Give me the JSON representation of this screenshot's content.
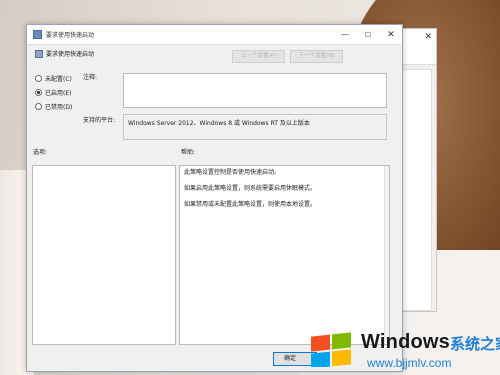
{
  "dialog": {
    "title": "要求使用快速启动",
    "policy_title": "要求使用快速启动",
    "prev_button": "上一个设置(P)",
    "next_button": "下一个设置(N)",
    "radios": [
      {
        "label": "未配置(C)",
        "selected": false
      },
      {
        "label": "已启用(E)",
        "selected": true
      },
      {
        "label": "已禁用(D)",
        "selected": false
      }
    ],
    "comment_label": "注释:",
    "comment_value": "",
    "platform_label": "支持的平台:",
    "platform_value": "Windows Server 2012、Windows 8 或 Windows RT 及以上版本",
    "options_label": "选项:",
    "help_label": "帮助:",
    "help_text": [
      "此策略设置控制是否使用快速启动。",
      "如果启用此策略设置，则系统需要启用休眠模式。",
      "如果禁用或未配置此策略设置，则使用本地设置。"
    ],
    "ok_button": "确定"
  },
  "watermark": {
    "brand": "Windows",
    "cn": "系统之家",
    "url": "www.bjjmlv.com",
    "colors": {
      "red": "#f25022",
      "green": "#7fba00",
      "blue": "#00a4ef",
      "yellow": "#ffb900"
    }
  },
  "icons": {
    "window_controls": [
      "minimize-icon",
      "maximize-icon",
      "close-icon"
    ]
  }
}
